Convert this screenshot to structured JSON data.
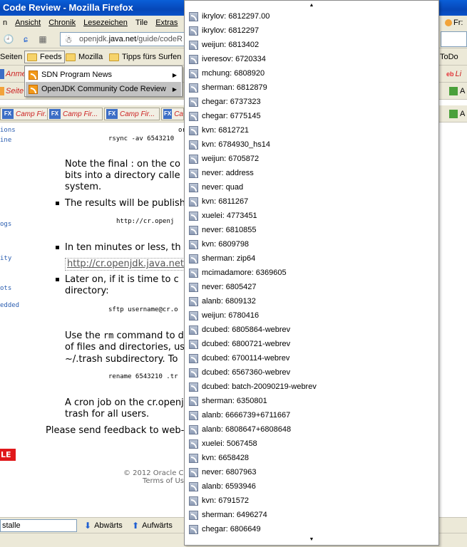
{
  "window": {
    "title": "Code Review - Mozilla Firefox"
  },
  "menubar": {
    "items": [
      "n",
      "Ansicht",
      "Chronik",
      "Lesezeichen",
      "Tile",
      "Extras"
    ]
  },
  "navbar": {
    "url_prefix": "openjdk.",
    "url_domain": "java.net",
    "url_suffix": "/guide/codeR"
  },
  "bookmarks": {
    "items": [
      "Seiten",
      "Feeds",
      "Mozilla",
      "Tipps fürs Surfen",
      "ToDo"
    ]
  },
  "toolbar2": {
    "left_label": "Anme",
    "right_label": "Li"
  },
  "toolbar3": {
    "left_label": "Seite"
  },
  "camp_tabs": [
    "Camp Fir...",
    "Camp Fir...",
    "Camp Fir...",
    "Ca"
  ],
  "right_edge": {
    "fr": "Fr:",
    "a1": "A",
    "a2": "A"
  },
  "feeds_menu": {
    "items": [
      {
        "label": "SDN Program News"
      },
      {
        "label": "OpenJDK Community Code Review"
      }
    ]
  },
  "page": {
    "side_links": [
      "ions",
      "ine",
      "ogs",
      "ity",
      "ots",
      "edded"
    ],
    "mono_lines": {
      "or": "or",
      "rsync": "rsync -av 6543210",
      "http": "http://cr.openj",
      "sftp": "sftp username@cr.o",
      "rename": "rename 6543210 .tr"
    },
    "para1": [
      "Note the final : on the co",
      "bits into a directory calle",
      "system."
    ],
    "bullet1": "The results will be publish",
    "bullet2": "In ten minutes or less, th",
    "link": "http://cr.openjdk.java.net",
    "bullet3": [
      "Later on, if it is time to c",
      "directory:"
    ],
    "para2_pre": "Use the ",
    "para2_code": "rm",
    "para2_post": " command to d",
    "para2": [
      "of files and directories, us",
      "~/.trash subdirectory. To"
    ],
    "para3": [
      "A cron job on the cr.openj",
      "trash for all users."
    ],
    "feedback": "Please send feedback to web-",
    "oracle": "LE",
    "footer1": "© 2012 Oracle C",
    "footer2": "Terms of Us"
  },
  "findbar": {
    "value": "stalle",
    "down": "Abwärts",
    "up": "Aufwärts"
  },
  "feed_list": [
    "ikrylov: 6812297.00",
    "ikrylov: 6812297",
    "weijun: 6813402",
    "iveresov: 6720334",
    "mchung: 6808920",
    "sherman: 6812879",
    "chegar: 6737323",
    "chegar: 6775145",
    "kvn: 6812721",
    "kvn: 6784930_hs14",
    "weijun: 6705872",
    "never: address",
    "never: quad",
    "kvn: 6811267",
    "xuelei: 4773451",
    "never: 6810855",
    "kvn: 6809798",
    "sherman: zip64",
    "mcimadamore: 6369605",
    "never: 6805427",
    "alanb: 6809132",
    "weijun: 6780416",
    "dcubed: 6805864-webrev",
    "dcubed: 6800721-webrev",
    "dcubed: 6700114-webrev",
    "dcubed: 6567360-webrev",
    "dcubed: batch-20090219-webrev",
    "sherman: 6350801",
    "alanb: 6666739+6711667",
    "alanb: 6808647+6808648",
    "xuelei: 5067458",
    "kvn: 6658428",
    "never: 6807963",
    "alanb: 6593946",
    "kvn: 6791572",
    "sherman: 6496274",
    "chegar: 6806649"
  ]
}
